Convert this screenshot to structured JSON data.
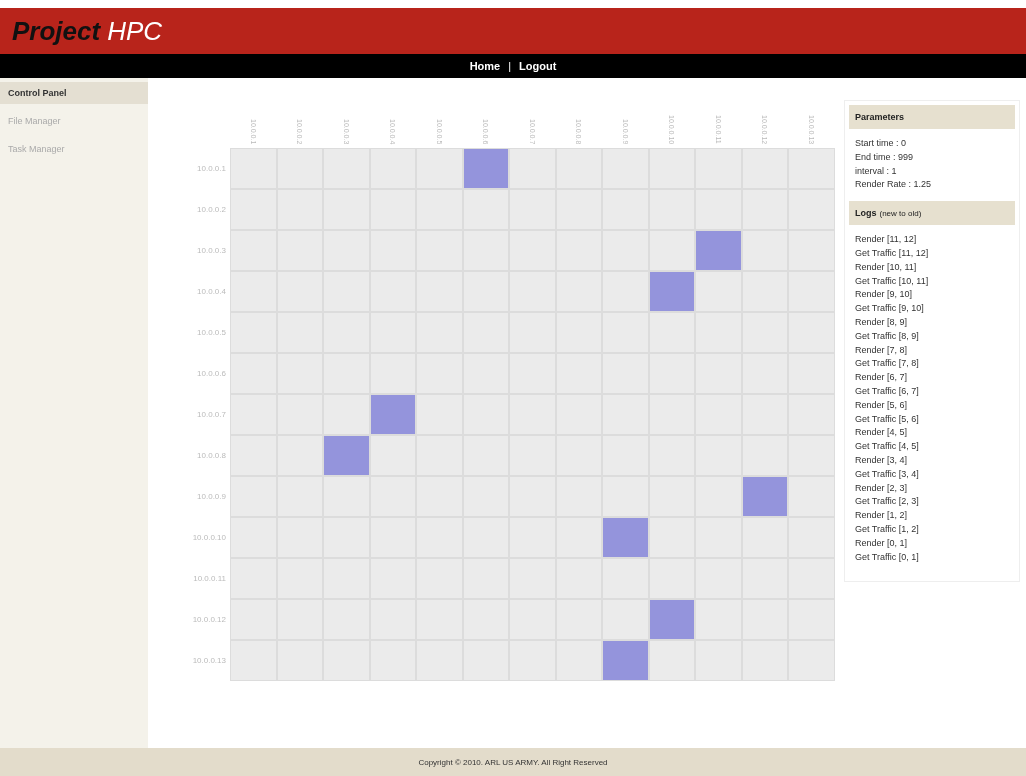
{
  "header": {
    "title_bold": "Project",
    "title_light": "HPC"
  },
  "nav": [
    "Home",
    "Logout"
  ],
  "nav_separator": "|",
  "sidebar": {
    "items": [
      {
        "label": "Control Panel",
        "selected": true
      },
      {
        "label": "File Manager",
        "selected": false
      },
      {
        "label": "Task Manager",
        "selected": false
      }
    ]
  },
  "matrix": {
    "columns": [
      "10.0.0.1",
      "10.0.0.2",
      "10.0.0.3",
      "10.0.0.4",
      "10.0.0.5",
      "10.0.0.6",
      "10.0.0.7",
      "10.0.0.8",
      "10.0.0.9",
      "10.0.0.10",
      "10.0.0.11",
      "10.0.0.12",
      "10.0.0.13"
    ],
    "rows": [
      {
        "label": "10.0.0.1",
        "cells": [
          false,
          false,
          false,
          false,
          false,
          true,
          false,
          false,
          false,
          false,
          false,
          false,
          false
        ]
      },
      {
        "label": "10.0.0.2",
        "cells": [
          false,
          false,
          false,
          false,
          false,
          false,
          false,
          false,
          false,
          false,
          false,
          false,
          false
        ]
      },
      {
        "label": "10.0.0.3",
        "cells": [
          false,
          false,
          false,
          false,
          false,
          false,
          false,
          false,
          false,
          false,
          true,
          false,
          false
        ]
      },
      {
        "label": "10.0.0.4",
        "cells": [
          false,
          false,
          false,
          false,
          false,
          false,
          false,
          false,
          false,
          true,
          false,
          false,
          false
        ]
      },
      {
        "label": "10.0.0.5",
        "cells": [
          false,
          false,
          false,
          false,
          false,
          false,
          false,
          false,
          false,
          false,
          false,
          false,
          false
        ]
      },
      {
        "label": "10.0.0.6",
        "cells": [
          false,
          false,
          false,
          false,
          false,
          false,
          false,
          false,
          false,
          false,
          false,
          false,
          false
        ]
      },
      {
        "label": "10.0.0.7",
        "cells": [
          false,
          false,
          false,
          true,
          false,
          false,
          false,
          false,
          false,
          false,
          false,
          false,
          false
        ]
      },
      {
        "label": "10.0.0.8",
        "cells": [
          false,
          false,
          true,
          false,
          false,
          false,
          false,
          false,
          false,
          false,
          false,
          false,
          false
        ]
      },
      {
        "label": "10.0.0.9",
        "cells": [
          false,
          false,
          false,
          false,
          false,
          false,
          false,
          false,
          false,
          false,
          false,
          true,
          false
        ]
      },
      {
        "label": "10.0.0.10",
        "cells": [
          false,
          false,
          false,
          false,
          false,
          false,
          false,
          false,
          true,
          false,
          false,
          false,
          false
        ]
      },
      {
        "label": "10.0.0.11",
        "cells": [
          false,
          false,
          false,
          false,
          false,
          false,
          false,
          false,
          false,
          false,
          false,
          false,
          false
        ]
      },
      {
        "label": "10.0.0.12",
        "cells": [
          false,
          false,
          false,
          false,
          false,
          false,
          false,
          false,
          false,
          true,
          false,
          false,
          false
        ]
      },
      {
        "label": "10.0.0.13",
        "cells": [
          false,
          false,
          false,
          false,
          false,
          false,
          false,
          false,
          true,
          false,
          false,
          false,
          false
        ]
      }
    ]
  },
  "parameters": {
    "title": "Parameters",
    "items": [
      "Start time : 0",
      "End time : 999",
      "interval : 1",
      "Render Rate : 1.25"
    ]
  },
  "logs": {
    "title": "Logs",
    "note": "(new to old)",
    "items": [
      "Render [11, 12]",
      "Get Traffic [11, 12]",
      "Render [10, 11]",
      "Get Traffic [10, 11]",
      "Render [9, 10]",
      "Get Traffic [9, 10]",
      "Render [8, 9]",
      "Get Traffic [8, 9]",
      "Render [7, 8]",
      "Get Traffic [7, 8]",
      "Render [6, 7]",
      "Get Traffic [6, 7]",
      "Render [5, 6]",
      "Get Traffic [5, 6]",
      "Render [4, 5]",
      "Get Traffic [4, 5]",
      "Render [3, 4]",
      "Get Traffic [3, 4]",
      "Render [2, 3]",
      "Get Traffic [2, 3]",
      "Render [1, 2]",
      "Get Traffic [1, 2]",
      "Render [0, 1]",
      "Get Traffic [0, 1]"
    ]
  },
  "footer": "Copyright © 2010. ARL US ARMY. All Right Reserved"
}
